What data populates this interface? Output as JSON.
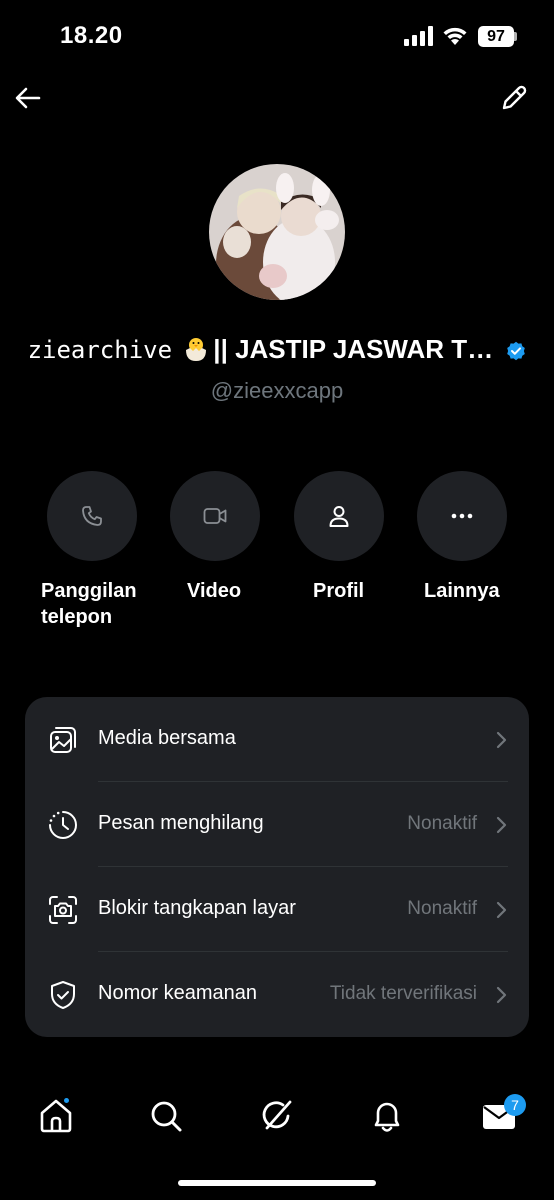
{
  "status_bar": {
    "time": "18.20",
    "battery": "97"
  },
  "profile": {
    "name_prefix": "ziearchive",
    "name_suffix": "|| JASTIP JASWAR T…",
    "handle": "@zieexxcapp"
  },
  "actions": [
    {
      "label_line1": "Panggilan",
      "label_line2": "telepon",
      "icon": "phone-icon"
    },
    {
      "label_line1": "Video",
      "icon": "video-icon"
    },
    {
      "label_line1": "Profil",
      "icon": "person-icon"
    },
    {
      "label_line1": "Lainnya",
      "icon": "more-icon"
    }
  ],
  "settings": [
    {
      "label": "Media bersama",
      "value": "",
      "icon": "media-icon"
    },
    {
      "label": "Pesan menghilang",
      "value": "Nonaktif",
      "icon": "timer-icon"
    },
    {
      "label": "Blokir tangkapan layar",
      "value": "Nonaktif",
      "icon": "screenshot-icon"
    },
    {
      "label": "Nomor keamanan",
      "value": "Tidak terverifikasi",
      "icon": "shield-icon"
    }
  ],
  "bottom_nav": {
    "messages_badge": "7"
  },
  "colors": {
    "accent": "#1d9bf0",
    "card": "#1f2125",
    "muted": "#71767b"
  }
}
